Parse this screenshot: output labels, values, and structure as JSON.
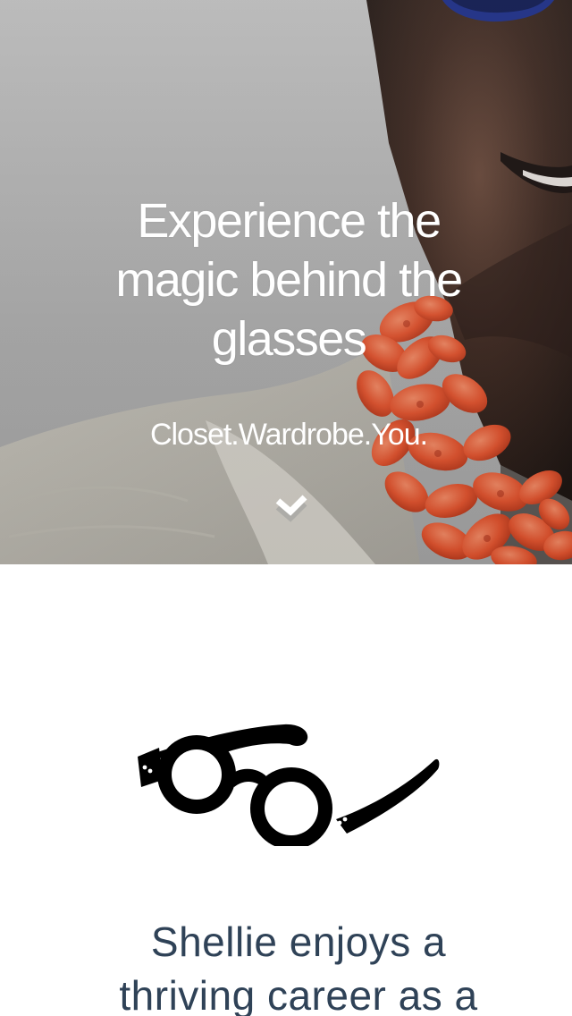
{
  "hero": {
    "title_lines": [
      "Experience the",
      "magic behind the",
      "glasses"
    ],
    "subtitle": "Closet.Wardrobe.You."
  },
  "intro": {
    "text_lines": [
      "Shellie enjoys a",
      "thriving career as a"
    ]
  },
  "icons": {
    "scroll": "chevron-down-icon",
    "logo": "glasses-icon"
  },
  "colors": {
    "hero_text": "#ffffff",
    "intro_text": "#2f4257",
    "necklace": "#e2542f"
  }
}
